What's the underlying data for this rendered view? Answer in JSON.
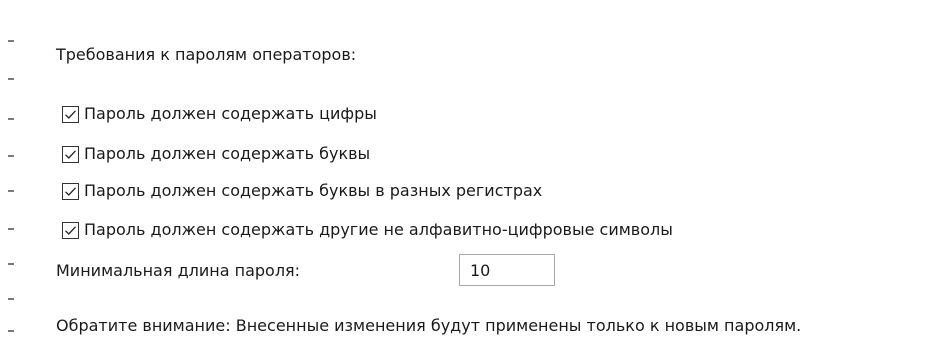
{
  "section_heading": "Требования к паролям операторов:",
  "checkboxes": [
    {
      "label": "Пароль должен содержать цифры",
      "checked": true
    },
    {
      "label": "Пароль должен содержать буквы",
      "checked": true
    },
    {
      "label": "Пароль должен содержать буквы в разных регистрах",
      "checked": true
    },
    {
      "label": "Пароль должен содержать другие не алфавитно-цифровые символы",
      "checked": true
    }
  ],
  "min_length": {
    "label": "Минимальная длина пароля:",
    "value": "10"
  },
  "notice": "Обратите внимание: Внесенные изменения будут применены только к новым паролям.",
  "colors": {
    "background": "#ffffff",
    "text": "#1a1a1a",
    "checkbox_border": "#333333",
    "input_border": "#a9a9a9",
    "side_ticks": "#7a7a7a"
  }
}
